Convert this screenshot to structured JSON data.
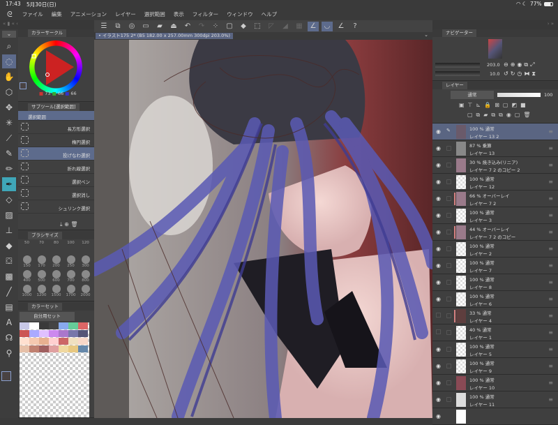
{
  "status": {
    "time": "17:43",
    "date": "5月30日(日)",
    "battery": "77%"
  },
  "menu": [
    "ファイル",
    "編集",
    "アニメーション",
    "レイヤー",
    "選択範囲",
    "表示",
    "フィルター",
    "ウィンドウ",
    "ヘルプ"
  ],
  "document_tab": "• イラスト175 2* (B5 182.00 x 257.00mm 300dpi 203.0%)",
  "color_circle": {
    "title": "カラーサークル",
    "r": "73",
    "g": "66",
    "b": "66",
    "main_color": "#494242"
  },
  "subtool": {
    "title": "サブツール[選択範囲]",
    "group": "選択範囲",
    "items": [
      "長方形選択",
      "楕円選択",
      "投げなわ選択",
      "折れ線選択",
      "選択ペン",
      "選択消し",
      "シュリンク選択"
    ],
    "selected": 2
  },
  "brush_size": {
    "title": "ブラシサイズ",
    "sizes": [
      "50",
      "70",
      "80",
      "100",
      "120",
      "150",
      "170",
      "200",
      "250",
      "300",
      "400",
      "500",
      "600",
      "700",
      "800",
      "1000",
      "1200",
      "1500",
      "1700",
      "2000"
    ]
  },
  "color_set": {
    "title": "カラーセット",
    "set_name": "自分用セット",
    "swatches": [
      "#c8c8e8",
      "#ffffff",
      "#3a3a3a",
      "#444",
      "#88aaee",
      "#66cc99",
      "#dd6666",
      "#cc5555",
      "#aaaaff",
      "#e0c0ff",
      "#cc88ee",
      "#aa77cc",
      "#7777aa",
      "#555577",
      "#ffe0d0",
      "#f5c8b0",
      "#e8b090",
      "#ffd0d0",
      "#cc6666",
      "#f0e0c0",
      "#f8d8c8",
      "#e6c0a8",
      "#c08070",
      "#a06060",
      "#e0a0a0",
      "#f0d8a0",
      "#e8c880",
      "#6688aa"
    ]
  },
  "navigator": {
    "title": "ナビゲーター",
    "zoom": "203.0",
    "rotate": "10.0"
  },
  "layer_panel": {
    "title": "レイヤー",
    "blend_mode": "通常",
    "opacity": "100"
  },
  "layers": [
    {
      "opacity_mode": "100 % 通常",
      "name": "レイヤー 13 2",
      "visible": true,
      "selected": true,
      "clip": false,
      "thumb": "#6a5a6a"
    },
    {
      "opacity_mode": "87 % 乗算",
      "name": "レイヤー 13",
      "visible": true,
      "clip": false,
      "thumb": "#888"
    },
    {
      "opacity_mode": "30 % 焼き込み(リニア)",
      "name": "レイヤー 7 2 のコピー 2",
      "visible": true,
      "clip": false,
      "thumb": "#9a7a8a"
    },
    {
      "opacity_mode": "100 % 通常",
      "name": "レイヤー 12",
      "visible": true,
      "clip": false,
      "thumb": ""
    },
    {
      "opacity_mode": "66 % オーバーレイ",
      "name": "レイヤー 7 2",
      "visible": true,
      "clip": true,
      "thumb": "#9a7a8a"
    },
    {
      "opacity_mode": "100 % 通常",
      "name": "レイヤー 3",
      "visible": true,
      "clip": false,
      "thumb": ""
    },
    {
      "opacity_mode": "44 % オーバーレイ",
      "name": "レイヤー 7 2 のコピー",
      "visible": true,
      "clip": true,
      "thumb": "#9a7a8a"
    },
    {
      "opacity_mode": "100 % 通常",
      "name": "レイヤー 2",
      "visible": true,
      "clip": false,
      "thumb": ""
    },
    {
      "opacity_mode": "100 % 通常",
      "name": "レイヤー 7",
      "visible": true,
      "clip": false,
      "thumb": ""
    },
    {
      "opacity_mode": "100 % 通常",
      "name": "レイヤー 8",
      "visible": true,
      "clip": false,
      "thumb": ""
    },
    {
      "opacity_mode": "100 % 通常",
      "name": "レイヤー 6",
      "visible": true,
      "clip": false,
      "thumb": ""
    },
    {
      "opacity_mode": "33 % 通常",
      "name": "レイヤー 4",
      "visible": false,
      "clip": true,
      "thumb": "#5e3e3e"
    },
    {
      "opacity_mode": "40 % 通常",
      "name": "レイヤー 1",
      "visible": false,
      "clip": false,
      "thumb": ""
    },
    {
      "opacity_mode": "100 % 通常",
      "name": "レイヤー 5",
      "visible": true,
      "clip": false,
      "thumb": ""
    },
    {
      "opacity_mode": "100 % 通常",
      "name": "レイヤー 9",
      "visible": true,
      "clip": false,
      "thumb": ""
    },
    {
      "opacity_mode": "100 % 通常",
      "name": "レイヤー 10",
      "visible": true,
      "clip": false,
      "thumb": "#8a4a55"
    },
    {
      "opacity_mode": "100 % 通常",
      "name": "レイヤー 11",
      "visible": true,
      "clip": false,
      "thumb": "#ddd"
    }
  ]
}
